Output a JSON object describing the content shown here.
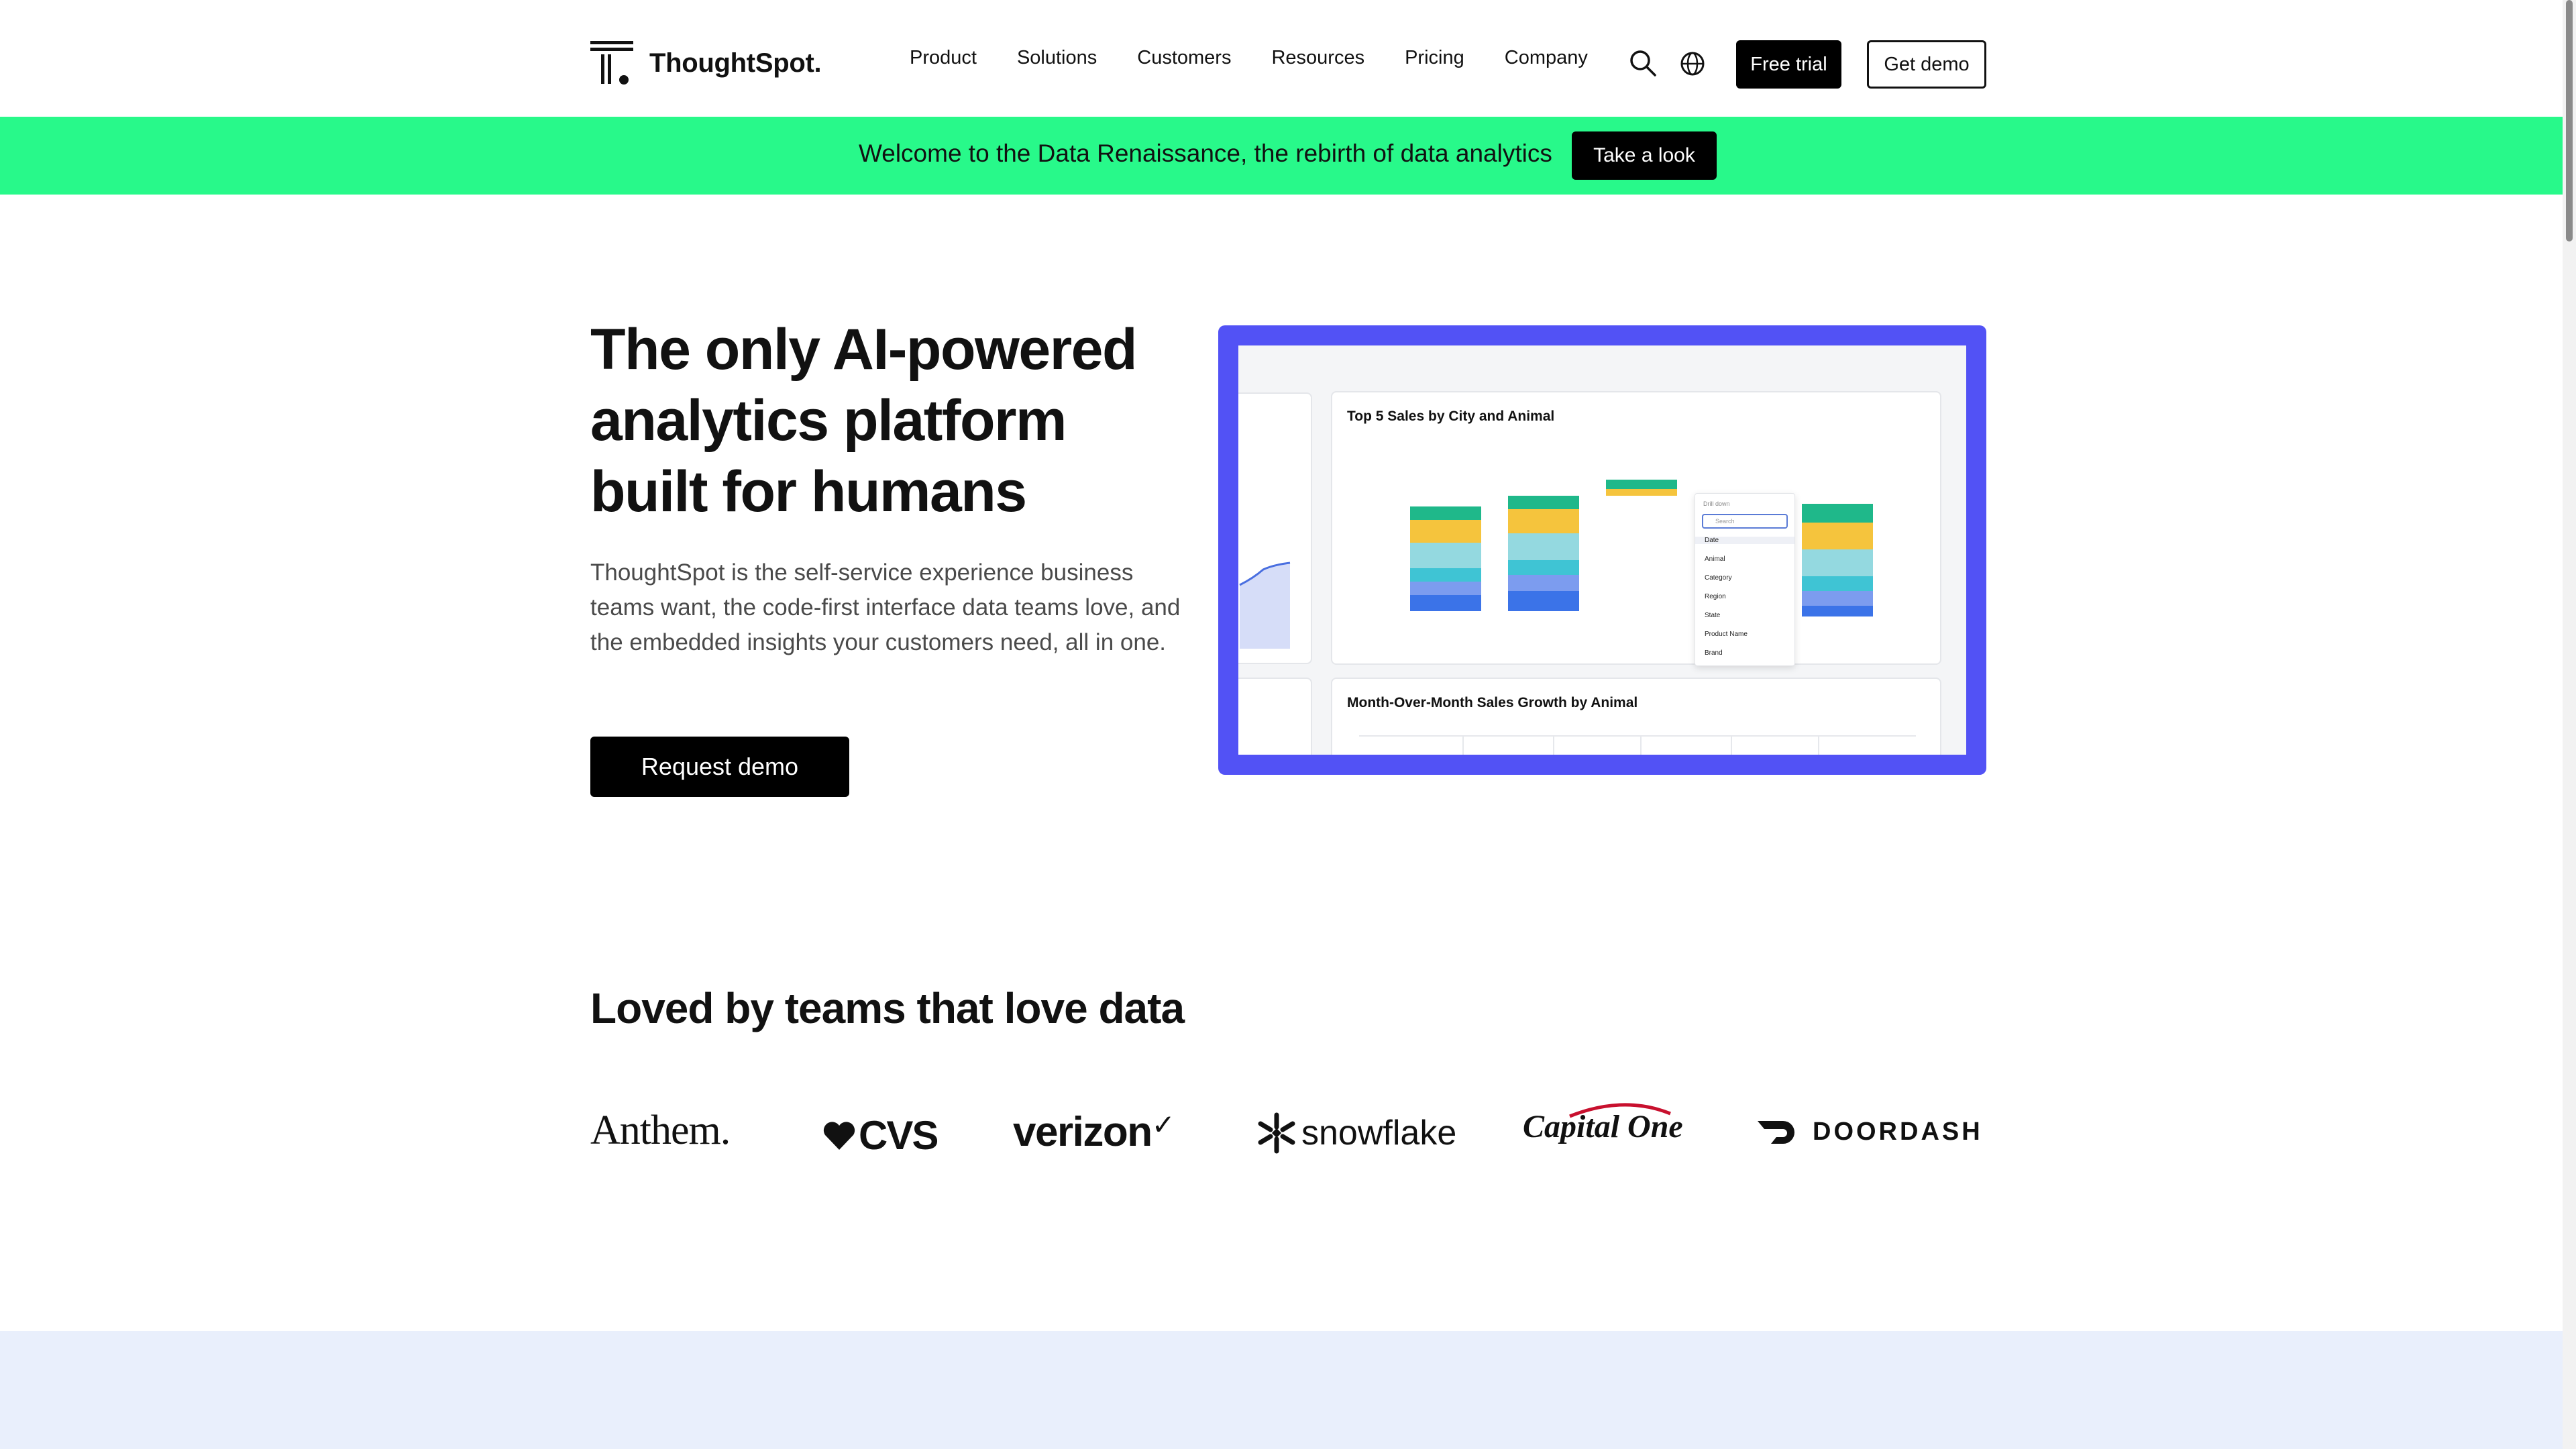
{
  "brand": {
    "name": "ThoughtSpot."
  },
  "nav": {
    "items": [
      "Product",
      "Solutions",
      "Customers",
      "Resources",
      "Pricing",
      "Company"
    ],
    "free_trial": "Free trial",
    "get_demo": "Get demo",
    "icons": [
      "search-icon",
      "globe-icon"
    ]
  },
  "banner": {
    "text": "Welcome to the Data Renaissance, the rebirth of data analytics",
    "button": "Take a look",
    "color": "#28f98a"
  },
  "hero": {
    "title_lines": [
      "The only AI-powered",
      "analytics platform",
      "built for humans"
    ],
    "description": "ThoughtSpot is the self-service experience business teams want, the code-first interface data teams love, and the embedded insights your customers need, all in one.",
    "cta": "Request demo"
  },
  "preview": {
    "frame_color": "#5252f5",
    "card1_title": "Top 5 Sales by City and Animal",
    "card2_title": "Month-Over-Month Sales Growth by Animal",
    "dropdown": {
      "header": "Drill down",
      "search_placeholder": "Search",
      "items": [
        "Date",
        "Animal",
        "Category",
        "Region",
        "State",
        "Product Name",
        "Brand"
      ]
    },
    "bar_colors": [
      "#1fb88a",
      "#f5c43d",
      "#94d9e0",
      "#3fc4d4",
      "#7c9cef",
      "#3b73e8"
    ]
  },
  "logos": {
    "title": "Loved by teams that love data",
    "companies": [
      "Anthem.",
      "CVS",
      "verizon",
      "snowflake",
      "Capital One",
      "DOORDASH"
    ]
  },
  "colors": {
    "accent": "#000000",
    "band": "#e9effc"
  }
}
